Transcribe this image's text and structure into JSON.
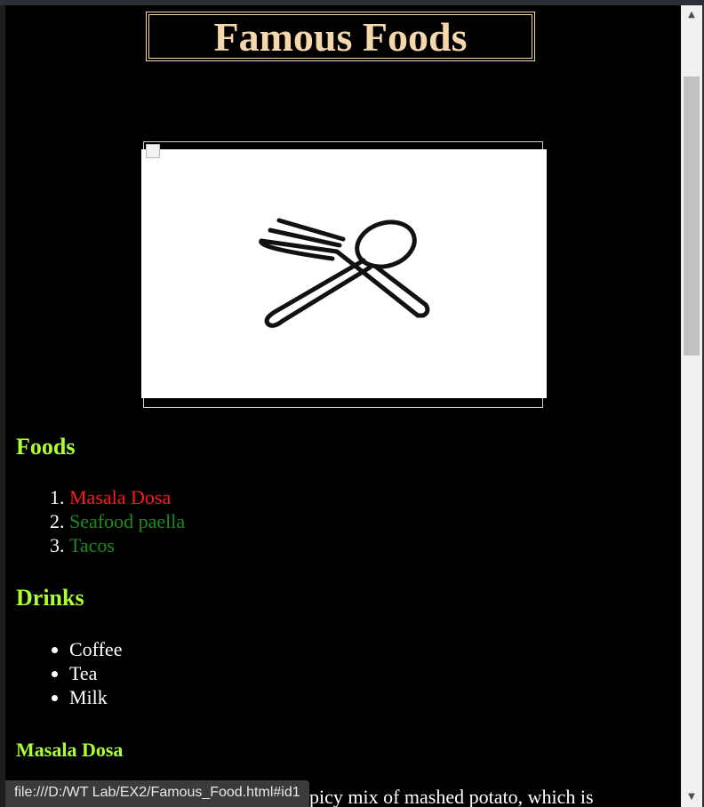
{
  "page": {
    "title": "Famous Foods",
    "image_alt": "cutlery image"
  },
  "foods": {
    "heading": "Foods",
    "items": [
      "Masala Dosa",
      "Seafood paella",
      "Tacos"
    ]
  },
  "drinks": {
    "heading": "Drinks",
    "items": [
      "Coffee",
      "Tea",
      "Milk"
    ]
  },
  "masala_section": {
    "heading": "Masala Dosa",
    "text_fragment": "picy mix of mashed potato, which is"
  },
  "status_bar": {
    "url": "file:///D:/WT Lab/EX2/Famous_Food.html#id1"
  },
  "colors": {
    "title": "#f5d7ab",
    "heading": "#adff2f",
    "first_food": "#ff1a1a",
    "other_foods": "#1f8b1f",
    "background": "#000000"
  },
  "icons": {
    "image_placeholder": "broken-image-icon",
    "scroll_up": "chevron-up-icon",
    "scroll_down": "chevron-down-icon"
  }
}
